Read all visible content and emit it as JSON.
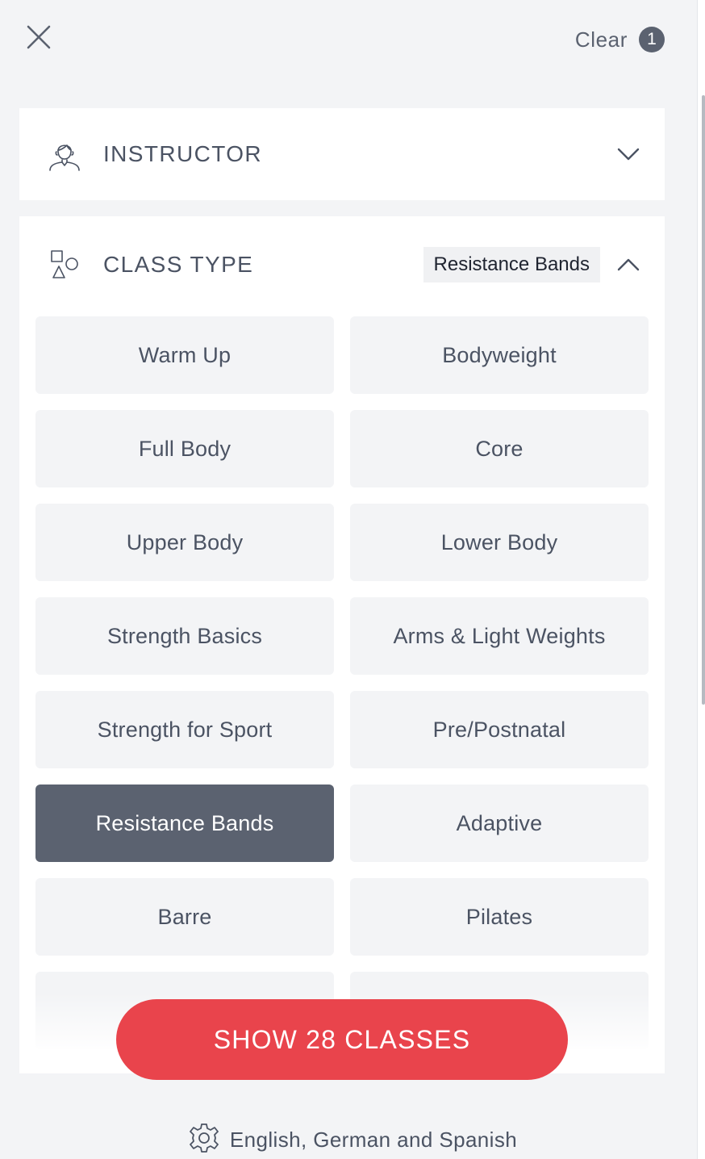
{
  "header": {
    "close_icon": "close-icon",
    "clear_label": "Clear",
    "clear_count": "1"
  },
  "instructor_section": {
    "title": "INSTRUCTOR",
    "icon": "instructor-icon",
    "expanded": false
  },
  "class_type_section": {
    "title": "CLASS TYPE",
    "icon": "shapes-icon",
    "selected_value": "Resistance Bands",
    "expanded": true,
    "options": [
      {
        "label": "Warm Up",
        "selected": false
      },
      {
        "label": "Bodyweight",
        "selected": false
      },
      {
        "label": "Full Body",
        "selected": false
      },
      {
        "label": "Core",
        "selected": false
      },
      {
        "label": "Upper Body",
        "selected": false
      },
      {
        "label": "Lower Body",
        "selected": false
      },
      {
        "label": "Strength Basics",
        "selected": false
      },
      {
        "label": "Arms & Light Weights",
        "selected": false
      },
      {
        "label": "Strength for Sport",
        "selected": false
      },
      {
        "label": "Pre/Postnatal",
        "selected": false
      },
      {
        "label": "Resistance Bands",
        "selected": true
      },
      {
        "label": "Adaptive",
        "selected": false
      },
      {
        "label": "Barre",
        "selected": false
      },
      {
        "label": "Pilates",
        "selected": false
      },
      {
        "label": "",
        "selected": false
      },
      {
        "label": "",
        "selected": false
      }
    ]
  },
  "footer": {
    "show_button": "SHOW 28 CLASSES",
    "language_icon": "gear-icon",
    "language_text": "English, German and Spanish"
  },
  "colors": {
    "accent": "#e9444c",
    "selected": "#5b6270",
    "option_bg": "#f3f4f6"
  }
}
